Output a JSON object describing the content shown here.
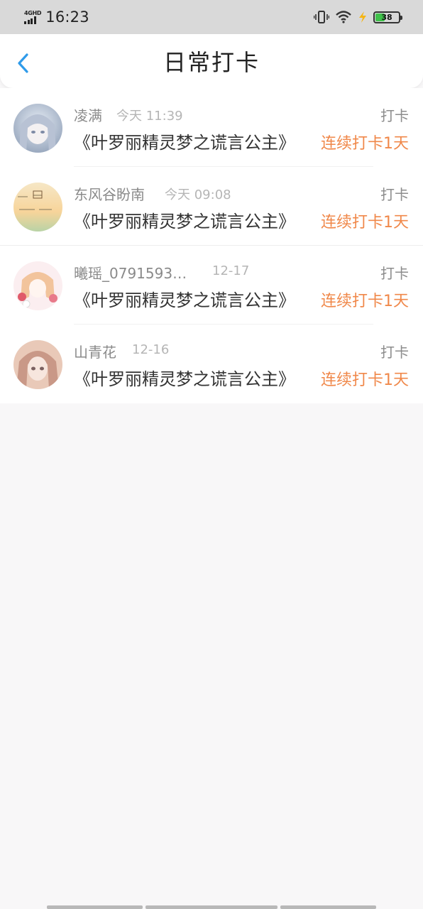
{
  "status_bar": {
    "network": "4GHD",
    "time": "16:23",
    "battery": "38",
    "icons": [
      "vibrate-icon",
      "wifi-icon",
      "charging-bolt-icon",
      "battery-icon"
    ],
    "bolt_color": "#f5b514",
    "battery_color": "#3fc14a"
  },
  "header": {
    "title": "日常打卡",
    "back_icon": "chevron-left-icon",
    "accent": "#2f9bea"
  },
  "records": [
    {
      "name": "凌满",
      "time": "今天 11:39",
      "type": "打卡",
      "book": "《叶罗丽精灵梦之谎言公主》",
      "streak": "连续打卡1天"
    },
    {
      "name": "东风谷盼南",
      "time": "今天 09:08",
      "type": "打卡",
      "book": "《叶罗丽精灵梦之谎言公主》",
      "streak": "连续打卡1天"
    },
    {
      "name": "曦瑶_0791593…",
      "time": "12-17",
      "type": "打卡",
      "book": "《叶罗丽精灵梦之谎言公主》",
      "streak": "连续打卡1天"
    },
    {
      "name": "山青花",
      "time": "12-16",
      "type": "打卡",
      "book": "《叶罗丽精灵梦之谎言公主》",
      "streak": "连续打卡1天"
    }
  ],
  "colors": {
    "streak": "#f0884a",
    "background": "#f8f7f8"
  }
}
